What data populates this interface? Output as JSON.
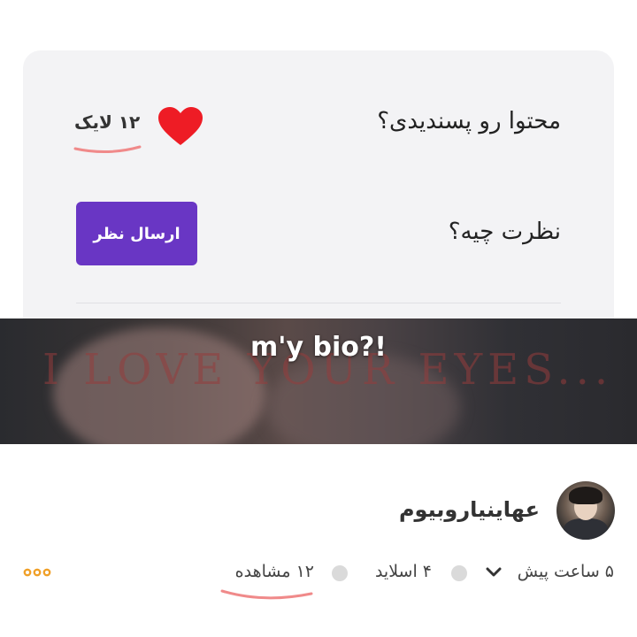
{
  "feedback": {
    "like_question": "محتوا رو پسندیدی؟",
    "like_count": "۱۲ لایک",
    "comment_question": "نظرت چیه؟",
    "send_comment_label": "ارسال نظر"
  },
  "banner": {
    "title": "m'y bio?!",
    "background_text": "I LOVE YOUR EYES..."
  },
  "post": {
    "username": "عهاینیاروبیوم",
    "time": "۵ ساعت پیش",
    "slides": "۴ اسلاید",
    "views": "۱۲ مشاهده"
  },
  "colors": {
    "accent": "#6936c4",
    "heart": "#ee1c25",
    "more_dots": "#f0a028",
    "annotation_underline": "#f08a8a"
  }
}
